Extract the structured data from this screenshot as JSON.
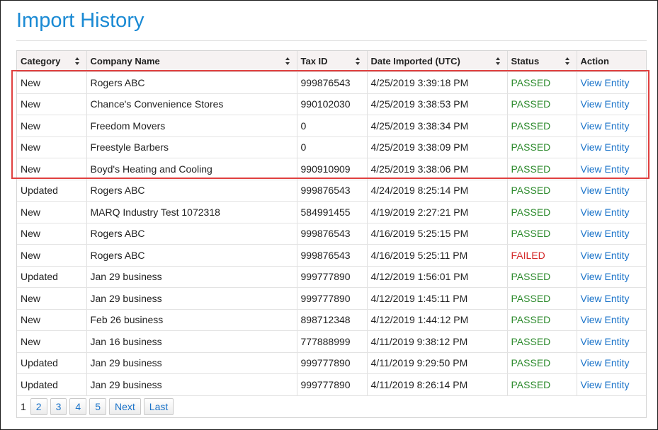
{
  "page": {
    "title": "Import History"
  },
  "table": {
    "columns": [
      {
        "label": "Category",
        "sortable": true
      },
      {
        "label": "Company Name",
        "sortable": true
      },
      {
        "label": "Tax ID",
        "sortable": true
      },
      {
        "label": "Date Imported (UTC)",
        "sortable": true
      },
      {
        "label": "Status",
        "sortable": true
      },
      {
        "label": "Action",
        "sortable": false
      }
    ],
    "rows": [
      {
        "category": "New",
        "company": "Rogers ABC",
        "tax_id": "999876543",
        "date": "4/25/2019 3:39:18 PM",
        "status": "PASSED",
        "action": "View Entity"
      },
      {
        "category": "New",
        "company": "Chance's Convenience Stores",
        "tax_id": "990102030",
        "date": "4/25/2019 3:38:53 PM",
        "status": "PASSED",
        "action": "View Entity"
      },
      {
        "category": "New",
        "company": "Freedom Movers",
        "tax_id": "0",
        "date": "4/25/2019 3:38:34 PM",
        "status": "PASSED",
        "action": "View Entity"
      },
      {
        "category": "New",
        "company": "Freestyle Barbers",
        "tax_id": "0",
        "date": "4/25/2019 3:38:09 PM",
        "status": "PASSED",
        "action": "View Entity"
      },
      {
        "category": "New",
        "company": "Boyd's Heating and Cooling",
        "tax_id": "990910909",
        "date": "4/25/2019 3:38:06 PM",
        "status": "PASSED",
        "action": "View Entity"
      },
      {
        "category": "Updated",
        "company": "Rogers ABC",
        "tax_id": "999876543",
        "date": "4/24/2019 8:25:14 PM",
        "status": "PASSED",
        "action": "View Entity"
      },
      {
        "category": "New",
        "company": "MARQ Industry Test 1072318",
        "tax_id": "584991455",
        "date": "4/19/2019 2:27:21 PM",
        "status": "PASSED",
        "action": "View Entity"
      },
      {
        "category": "New",
        "company": "Rogers ABC",
        "tax_id": "999876543",
        "date": "4/16/2019 5:25:15 PM",
        "status": "PASSED",
        "action": "View Entity"
      },
      {
        "category": "New",
        "company": "Rogers ABC",
        "tax_id": "999876543",
        "date": "4/16/2019 5:25:11 PM",
        "status": "FAILED",
        "action": "View Entity"
      },
      {
        "category": "Updated",
        "company": "Jan 29 business",
        "tax_id": "999777890",
        "date": "4/12/2019 1:56:01 PM",
        "status": "PASSED",
        "action": "View Entity"
      },
      {
        "category": "New",
        "company": "Jan 29 business",
        "tax_id": "999777890",
        "date": "4/12/2019 1:45:11 PM",
        "status": "PASSED",
        "action": "View Entity"
      },
      {
        "category": "New",
        "company": "Feb 26 business",
        "tax_id": "898712348",
        "date": "4/12/2019 1:44:12 PM",
        "status": "PASSED",
        "action": "View Entity"
      },
      {
        "category": "New",
        "company": "Jan 16 business",
        "tax_id": "777888999",
        "date": "4/11/2019 9:38:12 PM",
        "status": "PASSED",
        "action": "View Entity"
      },
      {
        "category": "Updated",
        "company": "Jan 29 business",
        "tax_id": "999777890",
        "date": "4/11/2019 9:29:50 PM",
        "status": "PASSED",
        "action": "View Entity"
      },
      {
        "category": "Updated",
        "company": "Jan 29 business",
        "tax_id": "999777890",
        "date": "4/11/2019 8:26:14 PM",
        "status": "PASSED",
        "action": "View Entity"
      }
    ]
  },
  "pagination": {
    "current": "1",
    "pages": [
      "2",
      "3",
      "4",
      "5"
    ],
    "next_label": "Next",
    "last_label": "Last"
  },
  "colors": {
    "title": "#1a8ad4",
    "link": "#1a73c9",
    "passed": "#2e8b2e",
    "failed": "#d42a2a",
    "highlight": "#e0403f",
    "header_bg": "#f6f2f2"
  }
}
